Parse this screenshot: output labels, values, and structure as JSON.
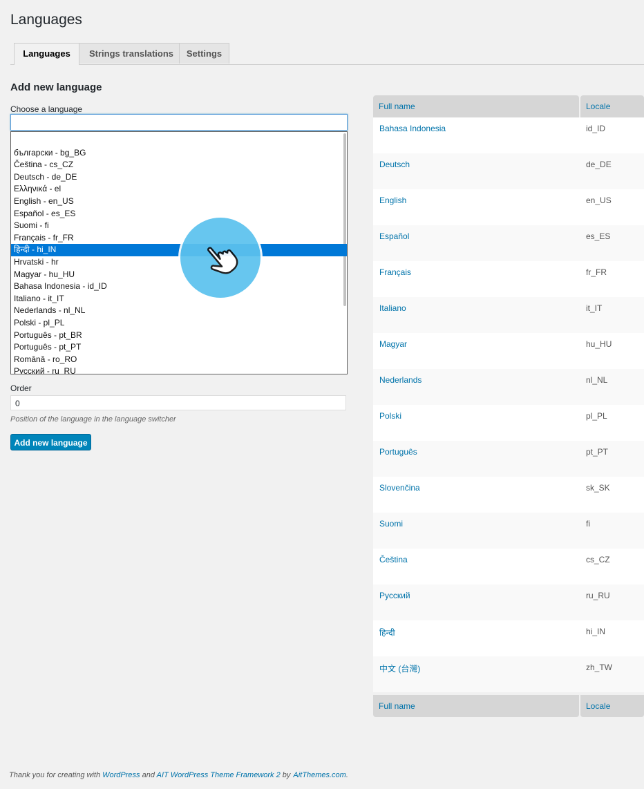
{
  "page": {
    "title": "Languages"
  },
  "tabs": [
    {
      "label": "Languages"
    },
    {
      "label": "Strings translations"
    },
    {
      "label": "Settings"
    }
  ],
  "form": {
    "section_title": "Add new language",
    "choose_label": "Choose a language",
    "search_value": "",
    "options": [
      "",
      "български - bg_BG",
      "Čeština - cs_CZ",
      "Deutsch - de_DE",
      "Ελληνικά - el",
      "English - en_US",
      "Español - es_ES",
      "Suomi - fi",
      "Français - fr_FR",
      "हिन्दी - hi_IN",
      "Hrvatski - hr",
      "Magyar - hu_HU",
      "Bahasa Indonesia - id_ID",
      "Italiano - it_IT",
      "Nederlands - nl_NL",
      "Polski - pl_PL",
      "Português - pt_BR",
      "Português - pt_PT",
      "Română - ro_RO",
      "Русский - ru_RU"
    ],
    "selected_option": "हिन्दी - hi_IN",
    "order_label": "Order",
    "order_value": "0",
    "order_hint": "Position of the language in the language switcher",
    "submit_label": "Add new language"
  },
  "table": {
    "headers": {
      "name": "Full name",
      "locale": "Locale"
    },
    "rows": [
      {
        "name": "Bahasa Indonesia",
        "locale": "id_ID"
      },
      {
        "name": "Deutsch",
        "locale": "de_DE"
      },
      {
        "name": "English",
        "locale": "en_US"
      },
      {
        "name": "Español",
        "locale": "es_ES"
      },
      {
        "name": "Français",
        "locale": "fr_FR"
      },
      {
        "name": "Italiano",
        "locale": "it_IT"
      },
      {
        "name": "Magyar",
        "locale": "hu_HU"
      },
      {
        "name": "Nederlands",
        "locale": "nl_NL"
      },
      {
        "name": "Polski",
        "locale": "pl_PL"
      },
      {
        "name": "Português",
        "locale": "pt_PT"
      },
      {
        "name": "Slovenčina",
        "locale": "sk_SK"
      },
      {
        "name": "Suomi",
        "locale": "fi"
      },
      {
        "name": "Čeština",
        "locale": "cs_CZ"
      },
      {
        "name": "Русский",
        "locale": "ru_RU"
      },
      {
        "name": "हिन्दी",
        "locale": "hi_IN"
      },
      {
        "name": "中文 (台灣)",
        "locale": "zh_TW"
      }
    ]
  },
  "footer": {
    "prefix": "Thank you for creating with",
    "link1": "WordPress",
    "mid": "and",
    "link2": "AIT WordPress Theme Framework 2",
    "by": "by",
    "link3": "AitThemes.com",
    "suffix": "."
  },
  "cursor": {
    "icon": "hand-pointer-icon",
    "accent": "#5cc2ee"
  },
  "colors": {
    "link": "#0073aa",
    "primary_button": "#0085ba",
    "selection": "#0078d7"
  }
}
